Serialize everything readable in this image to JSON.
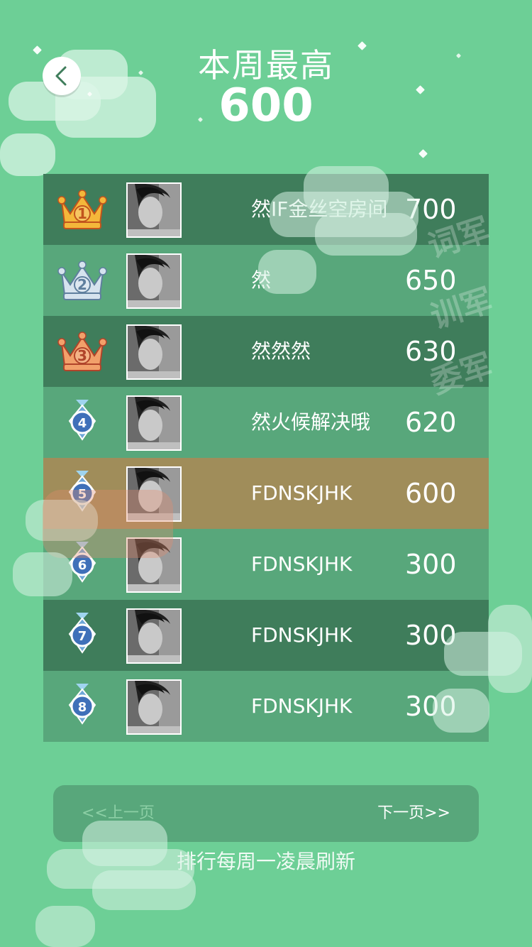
{
  "header": {
    "title": "本周最高",
    "best_score": "600"
  },
  "leaderboard": [
    {
      "rank": "1",
      "rank_icon": "gold-crown-icon",
      "name": "然IF金丝空房间",
      "score": "700",
      "row_style": "dark"
    },
    {
      "rank": "2",
      "rank_icon": "silver-crown-icon",
      "name": "然",
      "score": "650",
      "row_style": "light"
    },
    {
      "rank": "3",
      "rank_icon": "bronze-crown-icon",
      "name": "然然然",
      "score": "630",
      "row_style": "dark"
    },
    {
      "rank": "4",
      "rank_icon": "medal-icon",
      "name": "然火候解决哦",
      "score": "620",
      "row_style": "light"
    },
    {
      "rank": "5",
      "rank_icon": "medal-icon",
      "name": "FDNSKJHK",
      "score": "600",
      "row_style": "highlight"
    },
    {
      "rank": "6",
      "rank_icon": "medal-icon",
      "name": "FDNSKJHK",
      "score": "300",
      "row_style": "light"
    },
    {
      "rank": "7",
      "rank_icon": "medal-icon",
      "name": "FDNSKJHK",
      "score": "300",
      "row_style": "dark"
    },
    {
      "rank": "8",
      "rank_icon": "medal-icon",
      "name": "FDNSKJHK",
      "score": "300",
      "row_style": "light"
    }
  ],
  "pagination": {
    "prev_label": "<<上一页",
    "next_label": "下一页>>"
  },
  "footer": {
    "note": "排行每周一凌晨刷新"
  },
  "watermark": [
    "词军",
    "训军",
    "委军"
  ],
  "colors": {
    "background": "#6dcf96",
    "row_dark": "#3f7d5b",
    "row_light": "#58a77b",
    "row_highlight": "#a08d5a"
  }
}
